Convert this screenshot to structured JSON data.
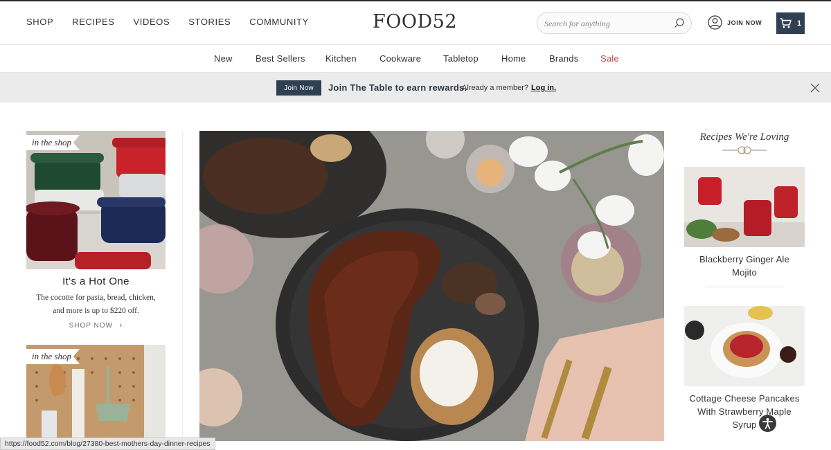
{
  "header": {
    "nav": [
      "SHOP",
      "RECIPES",
      "VIDEOS",
      "STORIES",
      "COMMUNITY"
    ],
    "logo": "FOOD52",
    "search_placeholder": "Search for anything",
    "join_label": "JOIN NOW",
    "cart_count": "1"
  },
  "subnav": [
    "New",
    "Best Sellers",
    "Kitchen",
    "Cookware",
    "Tabletop",
    "Home",
    "Brands",
    "Sale"
  ],
  "banner": {
    "button": "Join Now",
    "message": "Join The Table to earn rewards.",
    "already": "Already a member?",
    "login": "Log in."
  },
  "promos": [
    {
      "tag": "in the shop",
      "title": "It's a Hot One",
      "desc_line1": "The cocotte for pasta, bread, chicken,",
      "desc_line2": "and more is up to $220 off.",
      "cta": "SHOP NOW"
    },
    {
      "tag": "in the shop"
    }
  ],
  "right": {
    "heading": "Recipes We're Loving",
    "recipes": [
      {
        "title_line1": "Blackberry Ginger Ale",
        "title_line2": "Mojito"
      },
      {
        "title_line1": "Cottage Cheese Pancakes",
        "title_line2": "With Strawberry Maple",
        "title_line3": "Syrup"
      }
    ]
  },
  "status_url": "https://food52.com/blog/27380-best-mothers-day-dinner-recipes",
  "colors": {
    "navy": "#2e4051",
    "sale": "#b94c48"
  }
}
